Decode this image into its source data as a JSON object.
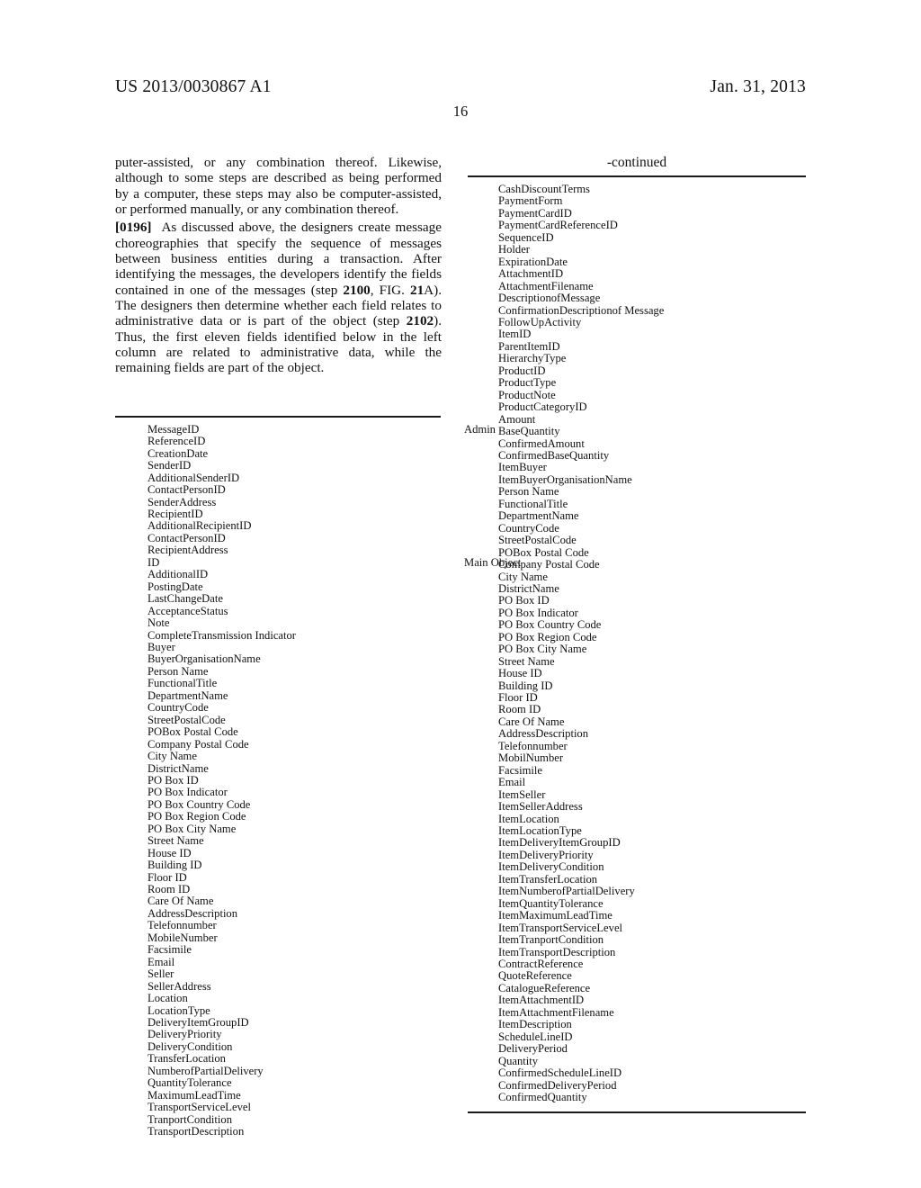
{
  "header": {
    "publication_number": "US 2013/0030867 A1",
    "publication_date": "Jan. 31, 2013",
    "page_number": "16"
  },
  "left_column": {
    "paragraphs": [
      {
        "id": "continued-paragraph",
        "text": "puter-assisted, or any combination thereof. Likewise, although to some steps are described as being performed by a computer, these steps may also be computer-assisted, or performed manually, or any combination thereof."
      },
      {
        "id": "paragraph-0196",
        "number": "[0196]",
        "text": "As discussed above, the designers create message choreographies that specify the sequence of messages between business entities during a transaction. After identifying the messages, the developers identify the fields contained in one of the messages (step 2100, FIG. 21A). The designers then determine whether each field relates to administrative data or is part of the object (step 2102). Thus, the first eleven fields identified below in the left column are related to administrative data, while the remaining fields are part of the object."
      }
    ],
    "table": {
      "group_labels": [
        {
          "label": "Admin",
          "row_index": 0
        },
        {
          "label": "Main Object",
          "row_index": 11
        }
      ],
      "fields": [
        "MessageID",
        "ReferenceID",
        "CreationDate",
        "SenderID",
        "AdditionalSenderID",
        "ContactPersonID",
        "SenderAddress",
        "RecipientID",
        "AdditionalRecipientID",
        "ContactPersonID",
        "RecipientAddress",
        "ID",
        "AdditionalID",
        "PostingDate",
        "LastChangeDate",
        "AcceptanceStatus",
        "Note",
        "CompleteTransmission Indicator",
        "Buyer",
        "BuyerOrganisationName",
        "Person Name",
        "FunctionalTitle",
        "DepartmentName",
        "CountryCode",
        "StreetPostalCode",
        "POBox Postal Code",
        "Company Postal Code",
        "City Name",
        "DistrictName",
        "PO Box ID",
        "PO Box Indicator",
        "PO Box Country Code",
        "PO Box Region Code",
        "PO Box City Name",
        "Street Name",
        "House ID",
        "Building ID",
        "Floor ID",
        "Room ID",
        "Care Of Name",
        "AddressDescription",
        "Telefonnumber",
        "MobileNumber",
        "Facsimile",
        "Email",
        "Seller",
        "SellerAddress",
        "Location",
        "LocationType",
        "DeliveryItemGroupID",
        "DeliveryPriority",
        "DeliveryCondition",
        "TransferLocation",
        "NumberofPartialDelivery",
        "QuantityTolerance",
        "MaximumLeadTime",
        "TransportServiceLevel",
        "TranportCondition",
        "TransportDescription"
      ]
    }
  },
  "right_column": {
    "table": {
      "title": "-continued",
      "fields": [
        "CashDiscountTerms",
        "PaymentForm",
        "PaymentCardID",
        "PaymentCardReferenceID",
        "SequenceID",
        "Holder",
        "ExpirationDate",
        "AttachmentID",
        "AttachmentFilename",
        "DescriptionofMessage",
        "ConfirmationDescriptionof Message",
        "FollowUpActivity",
        "ItemID",
        "ParentItemID",
        "HierarchyType",
        "ProductID",
        "ProductType",
        "ProductNote",
        "ProductCategoryID",
        "Amount",
        "BaseQuantity",
        "ConfirmedAmount",
        "ConfirmedBaseQuantity",
        "ItemBuyer",
        "ItemBuyerOrganisationName",
        "Person Name",
        "FunctionalTitle",
        "DepartmentName",
        "CountryCode",
        "StreetPostalCode",
        "POBox Postal Code",
        "Company Postal Code",
        "City Name",
        "DistrictName",
        "PO Box ID",
        "PO Box Indicator",
        "PO Box Country Code",
        "PO Box Region Code",
        "PO Box City Name",
        "Street Name",
        "House ID",
        "Building ID",
        "Floor ID",
        "Room ID",
        "Care Of Name",
        "AddressDescription",
        "Telefonnumber",
        "MobilNumber",
        "Facsimile",
        "Email",
        "ItemSeller",
        "ItemSellerAddress",
        "ItemLocation",
        "ItemLocationType",
        "ItemDeliveryItemGroupID",
        "ItemDeliveryPriority",
        "ItemDeliveryCondition",
        "ItemTransferLocation",
        "ItemNumberofPartialDelivery",
        "ItemQuantityTolerance",
        "ItemMaximumLeadTime",
        "ItemTransportServiceLevel",
        "ItemTranportCondition",
        "ItemTransportDescription",
        "ContractReference",
        "QuoteReference",
        "CatalogueReference",
        "ItemAttachmentID",
        "ItemAttachmentFilename",
        "ItemDescription",
        "ScheduleLineID",
        "DeliveryPeriod",
        "Quantity",
        "ConfirmedScheduleLineID",
        "ConfirmedDeliveryPeriod",
        "ConfirmedQuantity"
      ]
    }
  }
}
